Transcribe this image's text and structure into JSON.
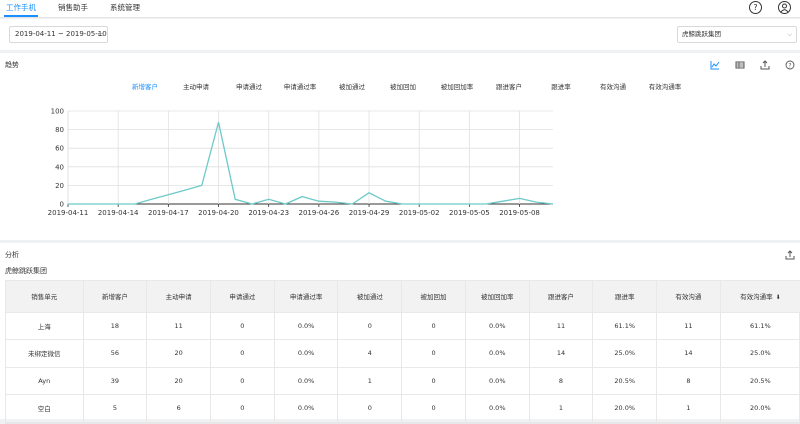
{
  "nav": {
    "tabs": [
      "工作手机",
      "销售助手",
      "系统管理"
    ],
    "help_icon": "?",
    "user_icon": "user"
  },
  "filter": {
    "date_range": "2019-04-11 ~ 2019-05-10",
    "organization": "虎鲸跳跃集团"
  },
  "trend": {
    "title": "趋势",
    "tools": [
      "line-chart-icon",
      "table-icon",
      "export-icon",
      "help-icon"
    ],
    "metrics": [
      "新增客户",
      "主动申请",
      "申请通过",
      "申请通过率",
      "被加通过",
      "被加回加",
      "被加回加率",
      "跟进客户",
      "跟进率",
      "有效沟通",
      "有效沟通率"
    ],
    "active_metric": "新增客户"
  },
  "chart_data": {
    "type": "line",
    "title": "",
    "xlabel": "",
    "ylabel": "",
    "ylim": [
      0,
      100
    ],
    "yticks": [
      0,
      20,
      40,
      60,
      80,
      100
    ],
    "xticks": [
      "2019-04-11",
      "2019-04-14",
      "2019-04-17",
      "2019-04-20",
      "2019-04-23",
      "2019-04-26",
      "2019-04-29",
      "2019-05-02",
      "2019-05-05",
      "2019-05-08"
    ],
    "x": [
      "2019-04-11",
      "2019-04-12",
      "2019-04-13",
      "2019-04-14",
      "2019-04-15",
      "2019-04-16",
      "2019-04-17",
      "2019-04-18",
      "2019-04-19",
      "2019-04-20",
      "2019-04-21",
      "2019-04-22",
      "2019-04-23",
      "2019-04-24",
      "2019-04-25",
      "2019-04-26",
      "2019-04-27",
      "2019-04-28",
      "2019-04-29",
      "2019-04-30",
      "2019-05-01",
      "2019-05-02",
      "2019-05-03",
      "2019-05-04",
      "2019-05-05",
      "2019-05-06",
      "2019-05-07",
      "2019-05-08",
      "2019-05-09",
      "2019-05-10"
    ],
    "series": [
      {
        "values": [
          0,
          0,
          0,
          0,
          0,
          5,
          10,
          15,
          20,
          88,
          5,
          0,
          5,
          0,
          8,
          3,
          2,
          0,
          12,
          3,
          0,
          0,
          0,
          0,
          0,
          0,
          3,
          6,
          2,
          0
        ],
        "color": "#6ccac9"
      }
    ],
    "grid": true
  },
  "analysis": {
    "title": "分析",
    "subtitle": "虎鲸跳跃集团",
    "export_icon": "export-icon",
    "columns": [
      "销售单元",
      "新增客户",
      "主动申请",
      "申请通过",
      "申请通过率",
      "被加通过",
      "被加回加",
      "被加回加率",
      "跟进客户",
      "跟进率",
      "有效沟通",
      "有效沟通率"
    ],
    "sort_icon": "⬇",
    "rows": [
      [
        "上海",
        "18",
        "11",
        "0",
        "0.0%",
        "0",
        "0",
        "0.0%",
        "11",
        "61.1%",
        "11",
        "61.1%"
      ],
      [
        "未绑定微信",
        "56",
        "20",
        "0",
        "0.0%",
        "4",
        "0",
        "0.0%",
        "14",
        "25.0%",
        "14",
        "25.0%"
      ],
      [
        "Ayn",
        "39",
        "20",
        "0",
        "0.0%",
        "1",
        "0",
        "0.0%",
        "8",
        "20.5%",
        "8",
        "20.5%"
      ],
      [
        "空白",
        "5",
        "6",
        "0",
        "0.0%",
        "0",
        "0",
        "0.0%",
        "1",
        "20.0%",
        "1",
        "20.0%"
      ]
    ]
  }
}
